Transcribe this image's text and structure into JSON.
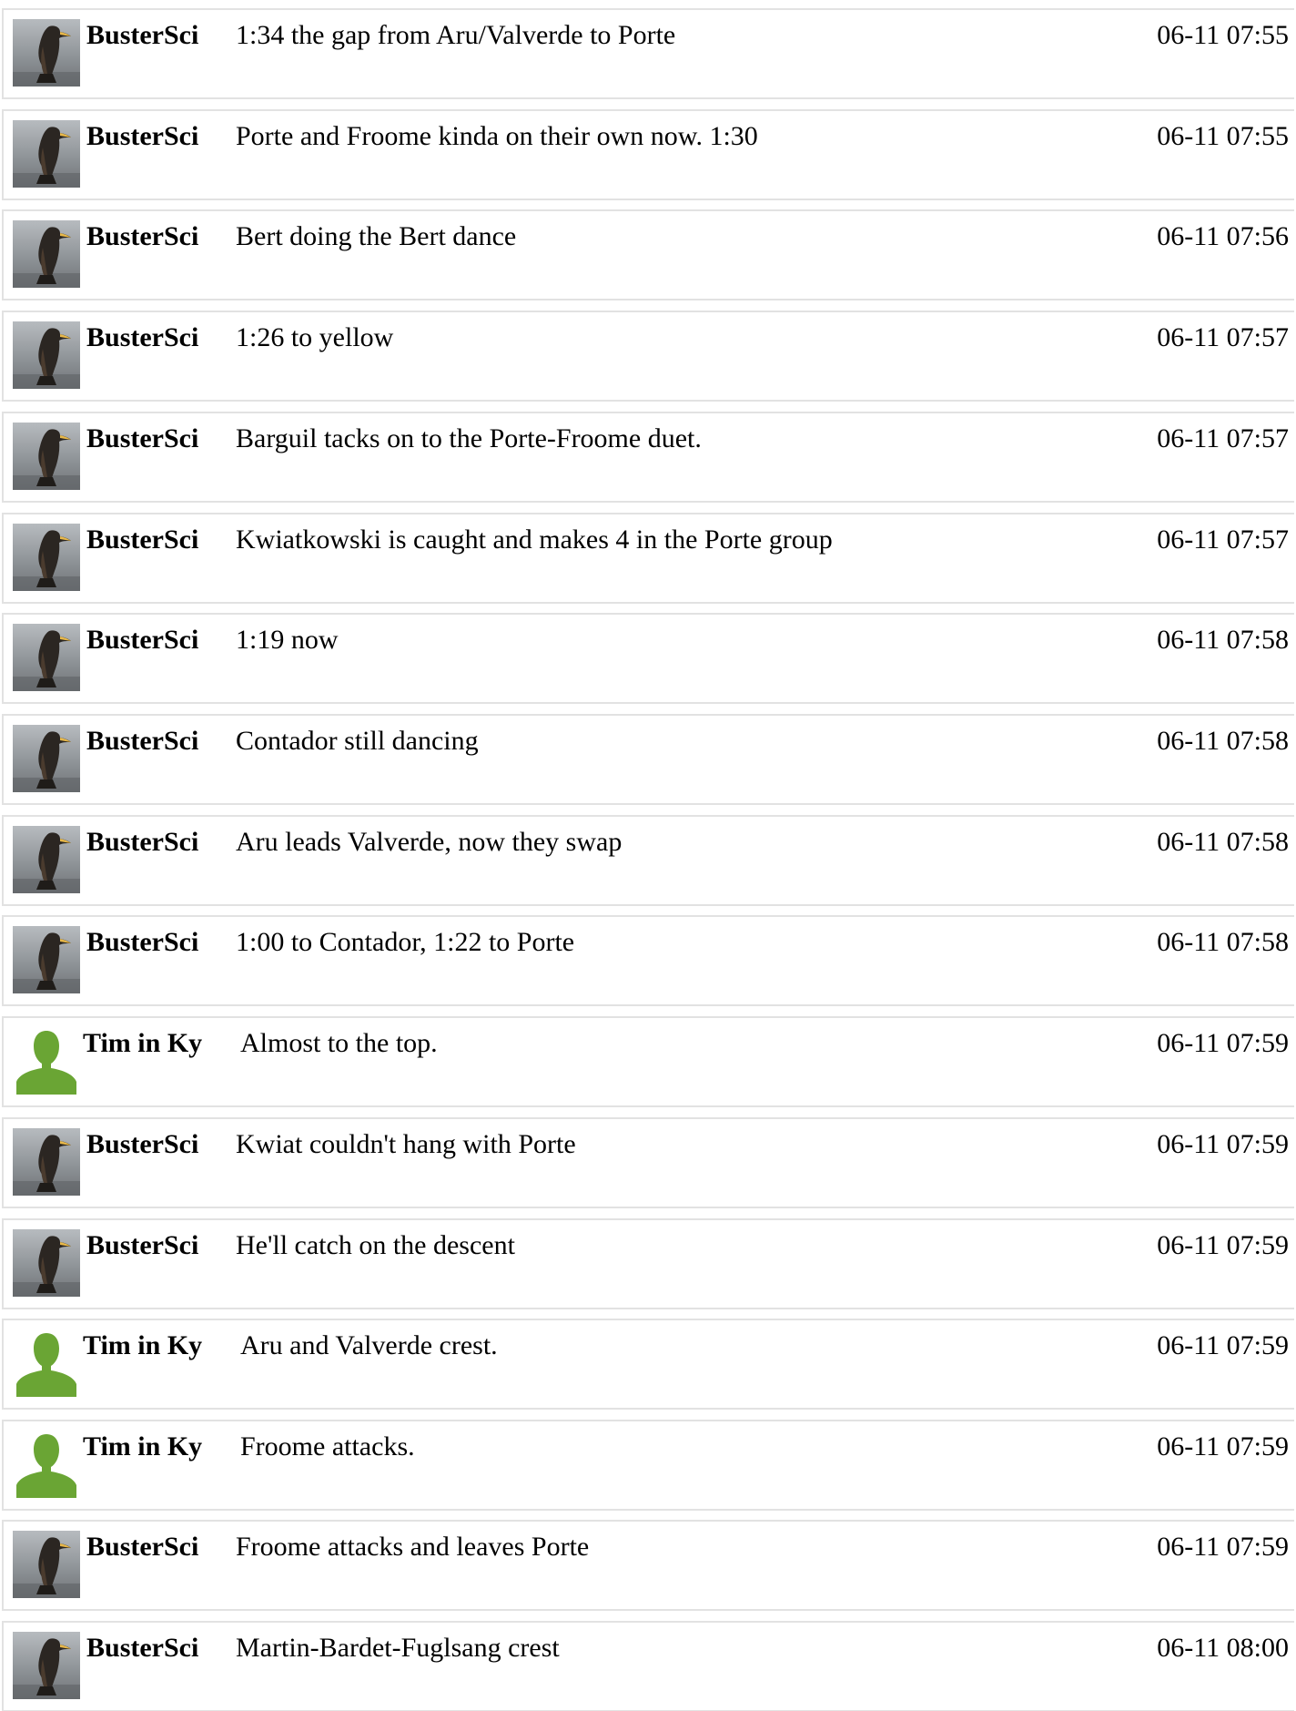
{
  "colors": {
    "row_border": "#e2e2e2",
    "person_icon_green": "#6aa534",
    "penguin_photo_bg": "#9a9ea3"
  },
  "messages": [
    {
      "user": "BusterSci",
      "avatar": "penguin-photo",
      "text": "1:34 the gap from Aru/Valverde to Porte",
      "time": "06-11 07:55"
    },
    {
      "user": "BusterSci",
      "avatar": "penguin-photo",
      "text": "Porte and Froome kinda on their own now. 1:30",
      "time": "06-11 07:55"
    },
    {
      "user": "BusterSci",
      "avatar": "penguin-photo",
      "text": "Bert doing the Bert dance",
      "time": "06-11 07:56"
    },
    {
      "user": "BusterSci",
      "avatar": "penguin-photo",
      "text": "1:26 to yellow",
      "time": "06-11 07:57"
    },
    {
      "user": "BusterSci",
      "avatar": "penguin-photo",
      "text": "Barguil tacks on to the Porte-Froome duet.",
      "time": "06-11 07:57"
    },
    {
      "user": "BusterSci",
      "avatar": "penguin-photo",
      "text": "Kwiatkowski is caught and makes 4 in the Porte group",
      "time": "06-11 07:57"
    },
    {
      "user": "BusterSci",
      "avatar": "penguin-photo",
      "text": "1:19 now",
      "time": "06-11 07:58"
    },
    {
      "user": "BusterSci",
      "avatar": "penguin-photo",
      "text": "Contador still dancing",
      "time": "06-11 07:58"
    },
    {
      "user": "BusterSci",
      "avatar": "penguin-photo",
      "text": "Aru leads Valverde, now they swap",
      "time": "06-11 07:58"
    },
    {
      "user": "BusterSci",
      "avatar": "penguin-photo",
      "text": "1:00 to Contador, 1:22 to Porte",
      "time": "06-11 07:58"
    },
    {
      "user": "Tim in Ky",
      "avatar": "person-silhouette-icon",
      "text": "Almost to the top.",
      "time": "06-11 07:59"
    },
    {
      "user": "BusterSci",
      "avatar": "penguin-photo",
      "text": "Kwiat couldn't hang with Porte",
      "time": "06-11 07:59"
    },
    {
      "user": "BusterSci",
      "avatar": "penguin-photo",
      "text": "He'll catch on the descent",
      "time": "06-11 07:59"
    },
    {
      "user": "Tim in Ky",
      "avatar": "person-silhouette-icon",
      "text": "Aru and Valverde crest.",
      "time": "06-11 07:59"
    },
    {
      "user": "Tim in Ky",
      "avatar": "person-silhouette-icon",
      "text": "Froome attacks.",
      "time": "06-11 07:59"
    },
    {
      "user": "BusterSci",
      "avatar": "penguin-photo",
      "text": "Froome attacks and leaves Porte",
      "time": "06-11 07:59"
    },
    {
      "user": "BusterSci",
      "avatar": "penguin-photo",
      "text": "Martin-Bardet-Fuglsang crest",
      "time": "06-11 08:00"
    }
  ]
}
